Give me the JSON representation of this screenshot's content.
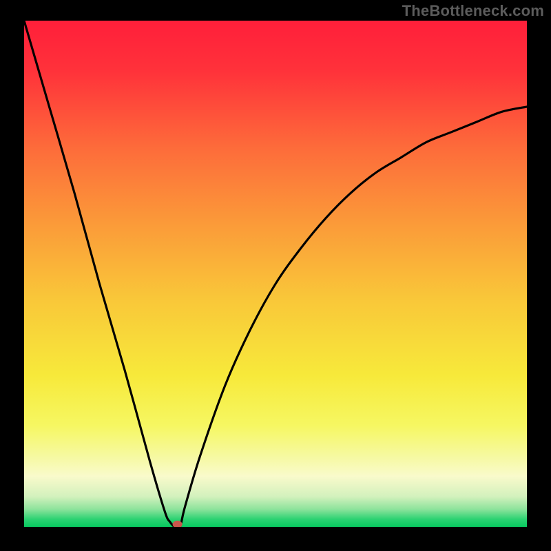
{
  "watermark": "TheBottleneck.com",
  "chart_data": {
    "type": "line",
    "title": "",
    "xlabel": "",
    "ylabel": "",
    "xlim": [
      0,
      100
    ],
    "ylim": [
      0,
      100
    ],
    "x": [
      0,
      5,
      10,
      15,
      20,
      25,
      28,
      29,
      30,
      31,
      32,
      35,
      40,
      45,
      50,
      55,
      60,
      65,
      70,
      75,
      80,
      85,
      90,
      95,
      100
    ],
    "y": [
      100,
      83,
      66,
      48,
      31,
      13,
      3,
      1,
      0,
      0,
      4,
      14,
      28,
      39,
      48,
      55,
      61,
      66,
      70,
      73,
      76,
      78,
      80,
      82,
      83
    ],
    "marker": {
      "x": 30.5,
      "y": 0.5,
      "color": "#c9564c"
    }
  },
  "gradient_stops": [
    {
      "offset": 0.0,
      "color": "#ff1f3a"
    },
    {
      "offset": 0.1,
      "color": "#ff323a"
    },
    {
      "offset": 0.25,
      "color": "#fd6b3a"
    },
    {
      "offset": 0.4,
      "color": "#fb9a39"
    },
    {
      "offset": 0.55,
      "color": "#f9c739"
    },
    {
      "offset": 0.7,
      "color": "#f7e93a"
    },
    {
      "offset": 0.8,
      "color": "#f6f762"
    },
    {
      "offset": 0.86,
      "color": "#f6f9a0"
    },
    {
      "offset": 0.9,
      "color": "#f9facb"
    },
    {
      "offset": 0.94,
      "color": "#d3f1bd"
    },
    {
      "offset": 0.965,
      "color": "#8de39c"
    },
    {
      "offset": 0.985,
      "color": "#2bd272"
    },
    {
      "offset": 1.0,
      "color": "#07c95f"
    }
  ]
}
